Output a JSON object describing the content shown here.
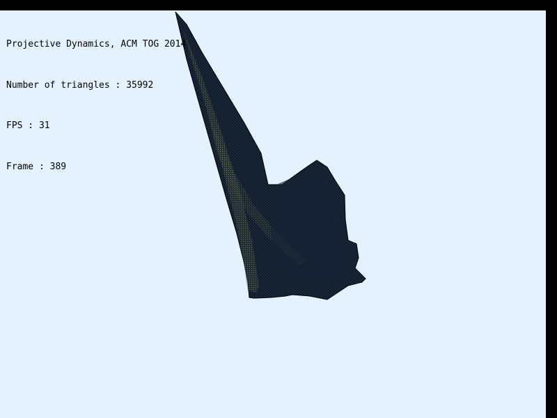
{
  "hud": {
    "title": "Projective Dynamics, ACM TOG 2014",
    "triangles_label": "Number of triangles",
    "triangles_value": "35992",
    "fps_label": "FPS",
    "fps_value": "31",
    "frame_label": "Frame",
    "frame_value": "389"
  },
  "scene": {
    "object": "cloth-mesh",
    "mesh_color": "#1d2f45",
    "mesh_edge_color": "#000000",
    "mesh_highlight_color": "#b8a04a",
    "background_color": "#e4f2ff"
  }
}
